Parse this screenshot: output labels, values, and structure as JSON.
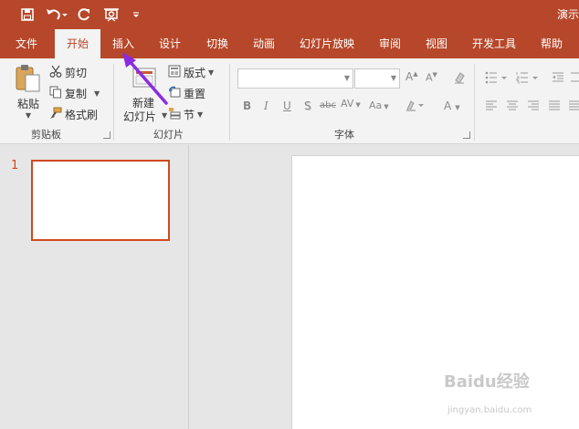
{
  "title_bar": {
    "doc_title": "演示",
    "icons": [
      "save-icon",
      "undo-icon",
      "redo-icon",
      "presenter-icon",
      "customize-quick-access-icon"
    ]
  },
  "tabs": [
    "文件",
    "开始",
    "插入",
    "设计",
    "切换",
    "动画",
    "幻灯片放映",
    "审阅",
    "视图",
    "开发工具",
    "帮助"
  ],
  "active_tab": "开始",
  "ribbon": {
    "clipboard": {
      "paste": "粘贴",
      "cut": "剪切",
      "copy": "复制",
      "format_painter": "格式刷",
      "group_label": "剪贴板"
    },
    "slides": {
      "new_slide_line1": "新建",
      "new_slide_line2": "幻灯片",
      "layout": "版式",
      "reset": "重置",
      "section": "节",
      "group_label": "幻灯片"
    },
    "font": {
      "font_name": "",
      "font_size": "",
      "bold": "B",
      "italic": "I",
      "underline": "U",
      "shadow": "S",
      "strike": "abc",
      "spacing": "AV",
      "case": "Aa",
      "group_label": "字体"
    }
  },
  "thumbnails": {
    "slide_number": "1"
  },
  "watermark": {
    "brand": "Baidu经验",
    "url": "jingyan.baidu.com"
  },
  "colors": {
    "accent": "#b7472a",
    "ribbon_bg": "#f3f3f3",
    "annotation_arrow": "#8a2be2"
  }
}
